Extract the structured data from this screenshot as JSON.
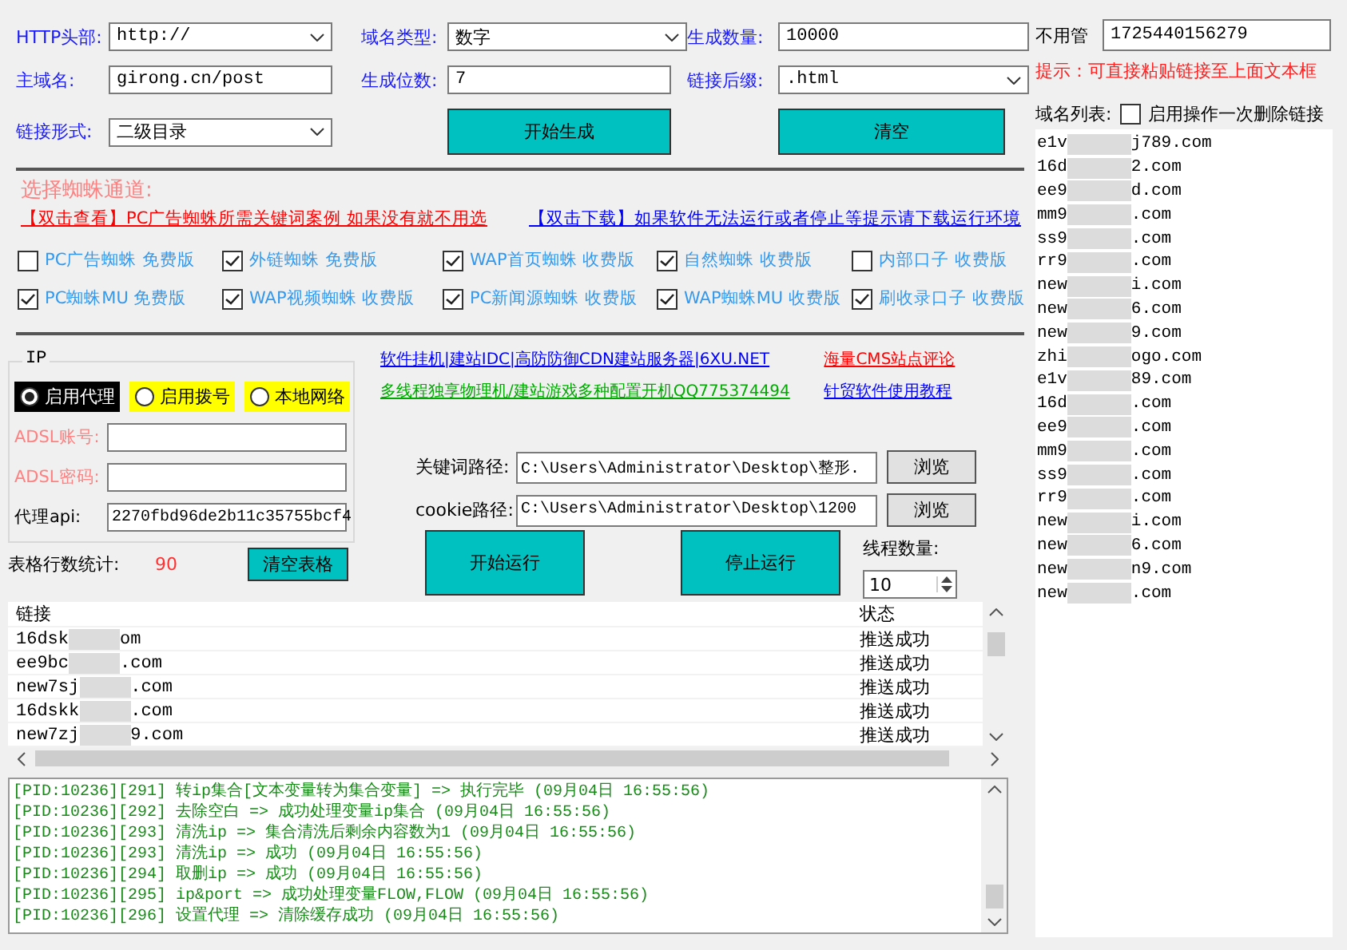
{
  "generator": {
    "rows": [
      [
        {
          "kind": "select",
          "label": "HTTP头部:",
          "value": "http://"
        },
        {
          "kind": "select",
          "label": "域名类型:",
          "value": "数字"
        },
        {
          "kind": "input",
          "label": "生成数量:",
          "value": "10000"
        }
      ],
      [
        {
          "kind": "input",
          "label": "主域名:",
          "value": "girong.cn/post"
        },
        {
          "kind": "input",
          "label": "生成位数:",
          "value": "7"
        },
        {
          "kind": "select",
          "label": "链接后缀:",
          "value": ".html"
        }
      ],
      [
        {
          "kind": "select",
          "label": "链接形式:",
          "value": "二级目录"
        },
        {
          "kind": "button",
          "label": "开始生成"
        },
        {
          "kind": "button",
          "label": "清空"
        }
      ]
    ]
  },
  "spiders": {
    "title": "选择蜘蛛通道:",
    "links": [
      {
        "text": "【双击查看】PC广告蜘蛛所需关键词案例 如果没有就不用选",
        "color": "#ff0000"
      },
      {
        "text": "【双击下载】如果软件无法运行或者停止等提示请下载运行环境",
        "color": "#0000ff"
      }
    ],
    "options": [
      {
        "label": "PC广告蜘蛛 免费版",
        "checked": false
      },
      {
        "label": "外链蜘蛛 免费版",
        "checked": true
      },
      {
        "label": "WAP首页蜘蛛 收费版",
        "checked": true
      },
      {
        "label": "自然蜘蛛 收费版",
        "checked": true
      },
      {
        "label": "内部口子 收费版",
        "checked": false
      },
      {
        "label": "PC蜘蛛MU 免费版",
        "checked": true
      },
      {
        "label": "WAP视频蜘蛛 收费版",
        "checked": true
      },
      {
        "label": "PC新闻源蜘蛛 收费版",
        "checked": true
      },
      {
        "label": "WAP蜘蛛MU 收费版",
        "checked": true
      },
      {
        "label": "刷收录口子 收费版",
        "checked": true
      }
    ]
  },
  "ip": {
    "title": "IP",
    "modes": [
      {
        "label": "启用代理",
        "selected": true
      },
      {
        "label": "启用拨号",
        "selected": false
      },
      {
        "label": "本地网络",
        "selected": false
      }
    ],
    "fields": [
      {
        "kind": "adsl",
        "label": "ADSL账号:"
      },
      {
        "kind": "adsl",
        "label": "ADSL密码:"
      },
      {
        "kind": "api",
        "label": "代理api:",
        "value": "2270fbd96de2b11c35755bcf4"
      }
    ]
  },
  "links": [
    {
      "text": "软件挂机|建站IDC|高防防御CDN建站服务器|6XU.NET",
      "color": "#0000ff"
    },
    {
      "text": "海量CMS站点评论",
      "color": "#ff0000"
    },
    {
      "text": "多线程独享物理机/建站游戏多种配置开机QQ775374494",
      "color": "#00aa00"
    },
    {
      "text": "针贸软件使用教程",
      "color": "#0000ff"
    }
  ],
  "paths": [
    {
      "label": "关键词路径:",
      "value": "C:\\Users\\Administrator\\Desktop\\整形.",
      "button": "浏览"
    },
    {
      "label": "cookie路径:",
      "value": "C:\\Users\\Administrator\\Desktop\\1200",
      "button": "浏览"
    }
  ],
  "run": {
    "start": "开始运行",
    "stop": "停止运行",
    "threads_label": "线程数量:",
    "threads": "10"
  },
  "stats": {
    "label": "表格行数统计:",
    "count": "90",
    "clear": "清空表格"
  },
  "table": {
    "columns": [
      "链接",
      "状态"
    ],
    "rows": [
      {
        "link_start": "16dsk",
        "link_end": "om",
        "status": "推送成功"
      },
      {
        "link_start": "ee9bc",
        "link_end": ".com",
        "status": "推送成功"
      },
      {
        "link_start": "new7sj",
        "link_end": ".com",
        "status": "推送成功"
      },
      {
        "link_start": "16dskk",
        "link_end": ".com",
        "status": "推送成功"
      },
      {
        "link_start": "new7zj",
        "link_end": "9.com",
        "status": "推送成功"
      }
    ]
  },
  "log": [
    "[PID:10236][291] 转ip集合[文本变量转为集合变量] => 执行完毕 (09月04日 16:55:56)",
    "[PID:10236][292] 去除空白 => 成功处理变量ip集合 (09月04日 16:55:56)",
    "[PID:10236][293] 清洗ip => 集合清洗后剩余内容数为1 (09月04日 16:55:56)",
    "[PID:10236][293] 清洗ip => 成功 (09月04日 16:55:56)",
    "[PID:10236][294] 取删ip => 成功 (09月04日 16:55:56)",
    "[PID:10236][295] ip&port => 成功处理变量FLOW,FLOW (09月04日 16:55:56)",
    "[PID:10236][296] 设置代理 => 清除缓存成功 (09月04日 16:55:56)"
  ],
  "side": {
    "ignore_label": "不用管",
    "ignore_value": "1725440156279",
    "hint": "提示：可直接粘贴链接至上面文本框",
    "list_label": "域名列表:",
    "delete_once": {
      "label": "启用操作一次删除链接",
      "checked": false
    },
    "domains": [
      {
        "start": "e1v",
        "end": "j789.com"
      },
      {
        "start": "16d",
        "end": "2.com"
      },
      {
        "start": "ee9",
        "end": "d.com"
      },
      {
        "start": "mm9",
        "end": ".com"
      },
      {
        "start": "ss9",
        "end": ".com"
      },
      {
        "start": "rr9",
        "end": ".com"
      },
      {
        "start": "new",
        "end": "i.com"
      },
      {
        "start": "new",
        "end": "6.com"
      },
      {
        "start": "new",
        "end": "9.com"
      },
      {
        "start": "zhi",
        "end": "ogo.com"
      },
      {
        "start": "e1v",
        "end": "89.com"
      },
      {
        "start": "16d",
        "end": ".com"
      },
      {
        "start": "ee9",
        "end": ".com"
      },
      {
        "start": "mm9",
        "end": ".com"
      },
      {
        "start": "ss9",
        "end": ".com"
      },
      {
        "start": "rr9",
        "end": ".com"
      },
      {
        "start": "new",
        "end": "i.com"
      },
      {
        "start": "new",
        "end": "6.com"
      },
      {
        "start": "new",
        "end": "n9.com"
      },
      {
        "start": "new",
        "end": ".com"
      }
    ]
  }
}
